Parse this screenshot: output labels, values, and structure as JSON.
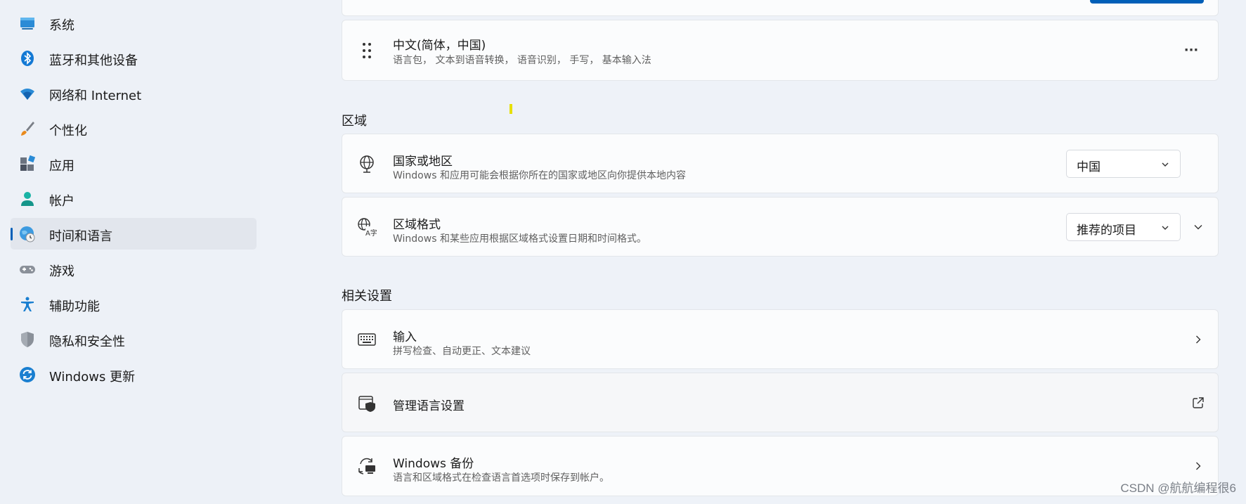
{
  "sidebar": {
    "items": [
      {
        "label": "系统",
        "icon": "monitor-icon"
      },
      {
        "label": "蓝牙和其他设备",
        "icon": "bluetooth-icon"
      },
      {
        "label": "网络和 Internet",
        "icon": "wifi-icon"
      },
      {
        "label": "个性化",
        "icon": "brush-icon"
      },
      {
        "label": "应用",
        "icon": "apps-icon"
      },
      {
        "label": "帐户",
        "icon": "account-icon"
      },
      {
        "label": "时间和语言",
        "icon": "time-language-icon",
        "active": true
      },
      {
        "label": "游戏",
        "icon": "gamepad-icon"
      },
      {
        "label": "辅助功能",
        "icon": "accessibility-icon"
      },
      {
        "label": "隐私和安全性",
        "icon": "shield-icon"
      },
      {
        "label": "Windows 更新",
        "icon": "update-icon"
      }
    ]
  },
  "language_card": {
    "title": "中文(简体，中国)",
    "subtitle": "语言包， 文本到语音转换， 语音识别， 手写， 基本输入法",
    "more": "···"
  },
  "region": {
    "heading": "区域",
    "country": {
      "title": "国家或地区",
      "subtitle": "Windows 和应用可能会根据你所在的国家或地区向你提供本地内容",
      "value": "中国"
    },
    "format": {
      "title": "区域格式",
      "subtitle": "Windows 和某些应用根据区域格式设置日期和时间格式。",
      "value": "推荐的项目"
    }
  },
  "related": {
    "heading": "相关设置",
    "typing": {
      "title": "输入",
      "subtitle": "拼写检查、自动更正、文本建议"
    },
    "manage": {
      "title": "管理语言设置"
    },
    "backup": {
      "title": "Windows 备份",
      "subtitle": "语言和区域格式在检查语言首选项时保存到帐户。"
    }
  },
  "watermark": "CSDN @航航编程很6",
  "colors": {
    "accent": "#005fb8",
    "background": "#eef2f8",
    "card": "#fbfcfd"
  }
}
